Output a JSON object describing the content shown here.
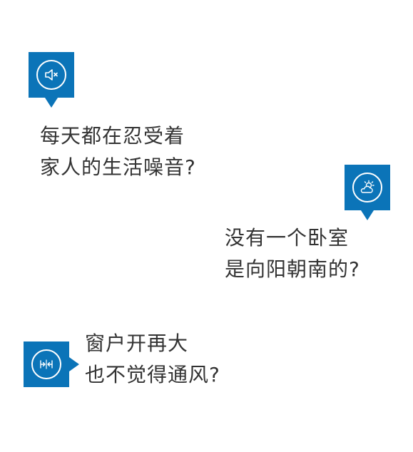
{
  "accent_color": "#0b74b8",
  "cards": [
    {
      "icon": "mute-icon",
      "lines": [
        "每天都在忍受着",
        "家人的生活噪音?"
      ]
    },
    {
      "icon": "sun-cloud-icon",
      "lines": [
        "没有一个卧室",
        "是向阳朝南的?"
      ]
    },
    {
      "icon": "window-ventilation-icon",
      "lines": [
        "窗户开再大",
        "也不觉得通风?"
      ]
    }
  ]
}
